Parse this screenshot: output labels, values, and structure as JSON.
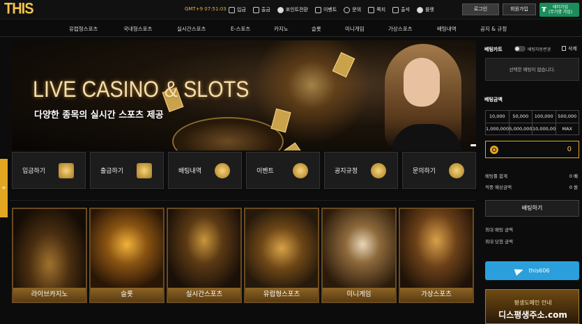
{
  "brand": {
    "logo": "THIS"
  },
  "clock": "GMT+9 07:51:03",
  "topnav": [
    {
      "label": "입금",
      "icon": "deposit-icon"
    },
    {
      "label": "출금",
      "icon": "withdraw-icon"
    },
    {
      "label": "포인트전환",
      "icon": "point-icon"
    },
    {
      "label": "이벤트",
      "icon": "gift-icon"
    },
    {
      "label": "문의",
      "icon": "headset-icon"
    },
    {
      "label": "쪽지",
      "icon": "mail-icon"
    },
    {
      "label": "출석",
      "icon": "calendar-icon"
    },
    {
      "label": "룰렛",
      "icon": "roulette-icon"
    }
  ],
  "auth": {
    "login": "로그인",
    "join": "회원가입",
    "tether_line1": "테더가입",
    "tether_line2": "(무기명 가입)",
    "tether_symbol": "₮"
  },
  "mainnav": [
    "유럽형스포츠",
    "국내형스포츠",
    "실시간스포츠",
    "E-스포츠",
    "카지노",
    "슬롯",
    "미니게임",
    "가상스포츠",
    "배팅내역",
    "공지 & 규정"
  ],
  "banner": {
    "title": "LIVE CASINO & SLOTS",
    "subtitle": "다양한 종목의 실시간 스포츠 제공"
  },
  "quick": [
    "입금하기",
    "출금하기",
    "배팅내역",
    "이벤트",
    "공지규정",
    "문의하기"
  ],
  "sidetab": "»",
  "games": [
    "라이브카지노",
    "슬롯",
    "실시간스포츠",
    "유럽형스포츠",
    "미니게임",
    "가상스포츠"
  ],
  "betslip": {
    "title": "베팅카트",
    "auto": "배팅자동변경",
    "delete": "삭제",
    "empty": "선택한 배팅이 없습니다.",
    "amount_title": "베팅금액",
    "amounts": [
      "10,000",
      "50,000",
      "100,000",
      "500,000",
      "1,000,000",
      "5,000,000",
      "10,000,000",
      "MAX"
    ],
    "input_value": "0",
    "total_odds_label": "배팅률 합계",
    "total_odds_value": "0 배",
    "expected_label": "적중 예상금액",
    "expected_value": "0 원",
    "bet_button": "배팅하기",
    "max_bet": "최대 배팅 금액",
    "max_win": "최대 당첨 금액"
  },
  "telegram": "this606",
  "promo": {
    "line1": "평생도메인 안내",
    "line2": "디스평생주소.com"
  },
  "colors": {
    "accent": "#e3a623",
    "telegram": "#2a9fdc",
    "tether": "#1c8c5a"
  }
}
